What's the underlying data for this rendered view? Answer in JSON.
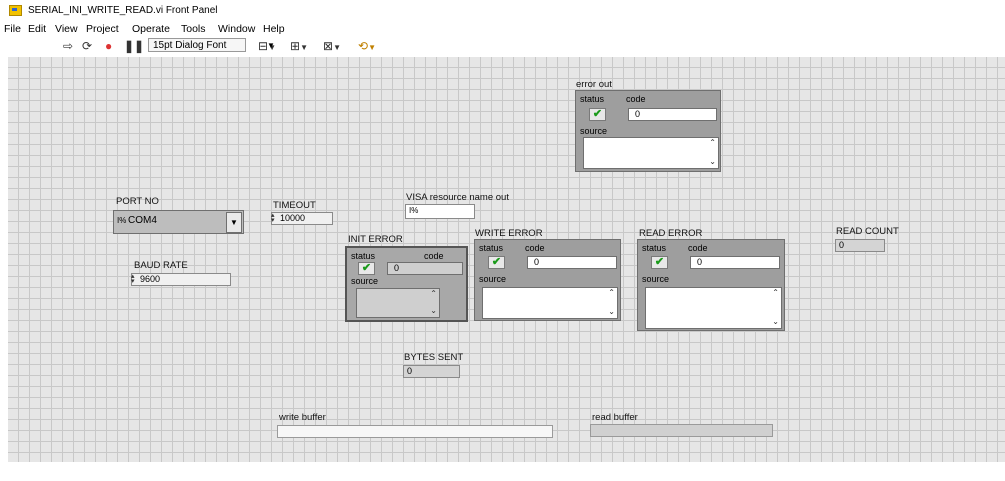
{
  "window": {
    "title": "SERIAL_INI_WRITE_READ.vi Front Panel"
  },
  "menu": {
    "items": [
      "File",
      "Edit",
      "View",
      "Project",
      "Operate",
      "Tools",
      "Window",
      "Help"
    ]
  },
  "toolbar": {
    "font": "15pt Dialog Font"
  },
  "controls": {
    "port_no": {
      "label": "PORT NO",
      "value": "COM4",
      "prefix": "I%"
    },
    "baud_rate": {
      "label": "BAUD RATE",
      "value": "9600"
    },
    "timeout": {
      "label": "TIMEOUT",
      "value": "10000"
    },
    "visa": {
      "label": "VISA resource name out",
      "prefix": "I%"
    },
    "read_count": {
      "label": "READ COUNT",
      "value": "0"
    },
    "bytes_sent": {
      "label": "BYTES SENT",
      "value": "0"
    },
    "write_buffer": {
      "label": "write buffer",
      "value": ""
    },
    "read_buffer": {
      "label": "read buffer",
      "value": ""
    }
  },
  "clusters": {
    "error_out": {
      "label": "error out",
      "status_label": "status",
      "code_label": "code",
      "code_value": "0",
      "source_label": "source"
    },
    "init_error": {
      "label": "INIT ERROR",
      "status_label": "status",
      "code_label": "code",
      "code_value": "0",
      "source_label": "source"
    },
    "write_error": {
      "label": "WRITE ERROR",
      "status_label": "status",
      "code_label": "code",
      "code_value": "0",
      "source_label": "source"
    },
    "read_error": {
      "label": "READ ERROR",
      "status_label": "status",
      "code_label": "code",
      "code_value": "0",
      "source_label": "source"
    }
  },
  "icons": {
    "check": "✔",
    "scroll_up": "⌃",
    "scroll_down": "⌄",
    "dropdown": "▼"
  },
  "colors": {
    "panel": "#e6e6e6",
    "grid": "#c8c8c8",
    "cluster": "#9e9e9e",
    "check": "#1a9a1a"
  }
}
